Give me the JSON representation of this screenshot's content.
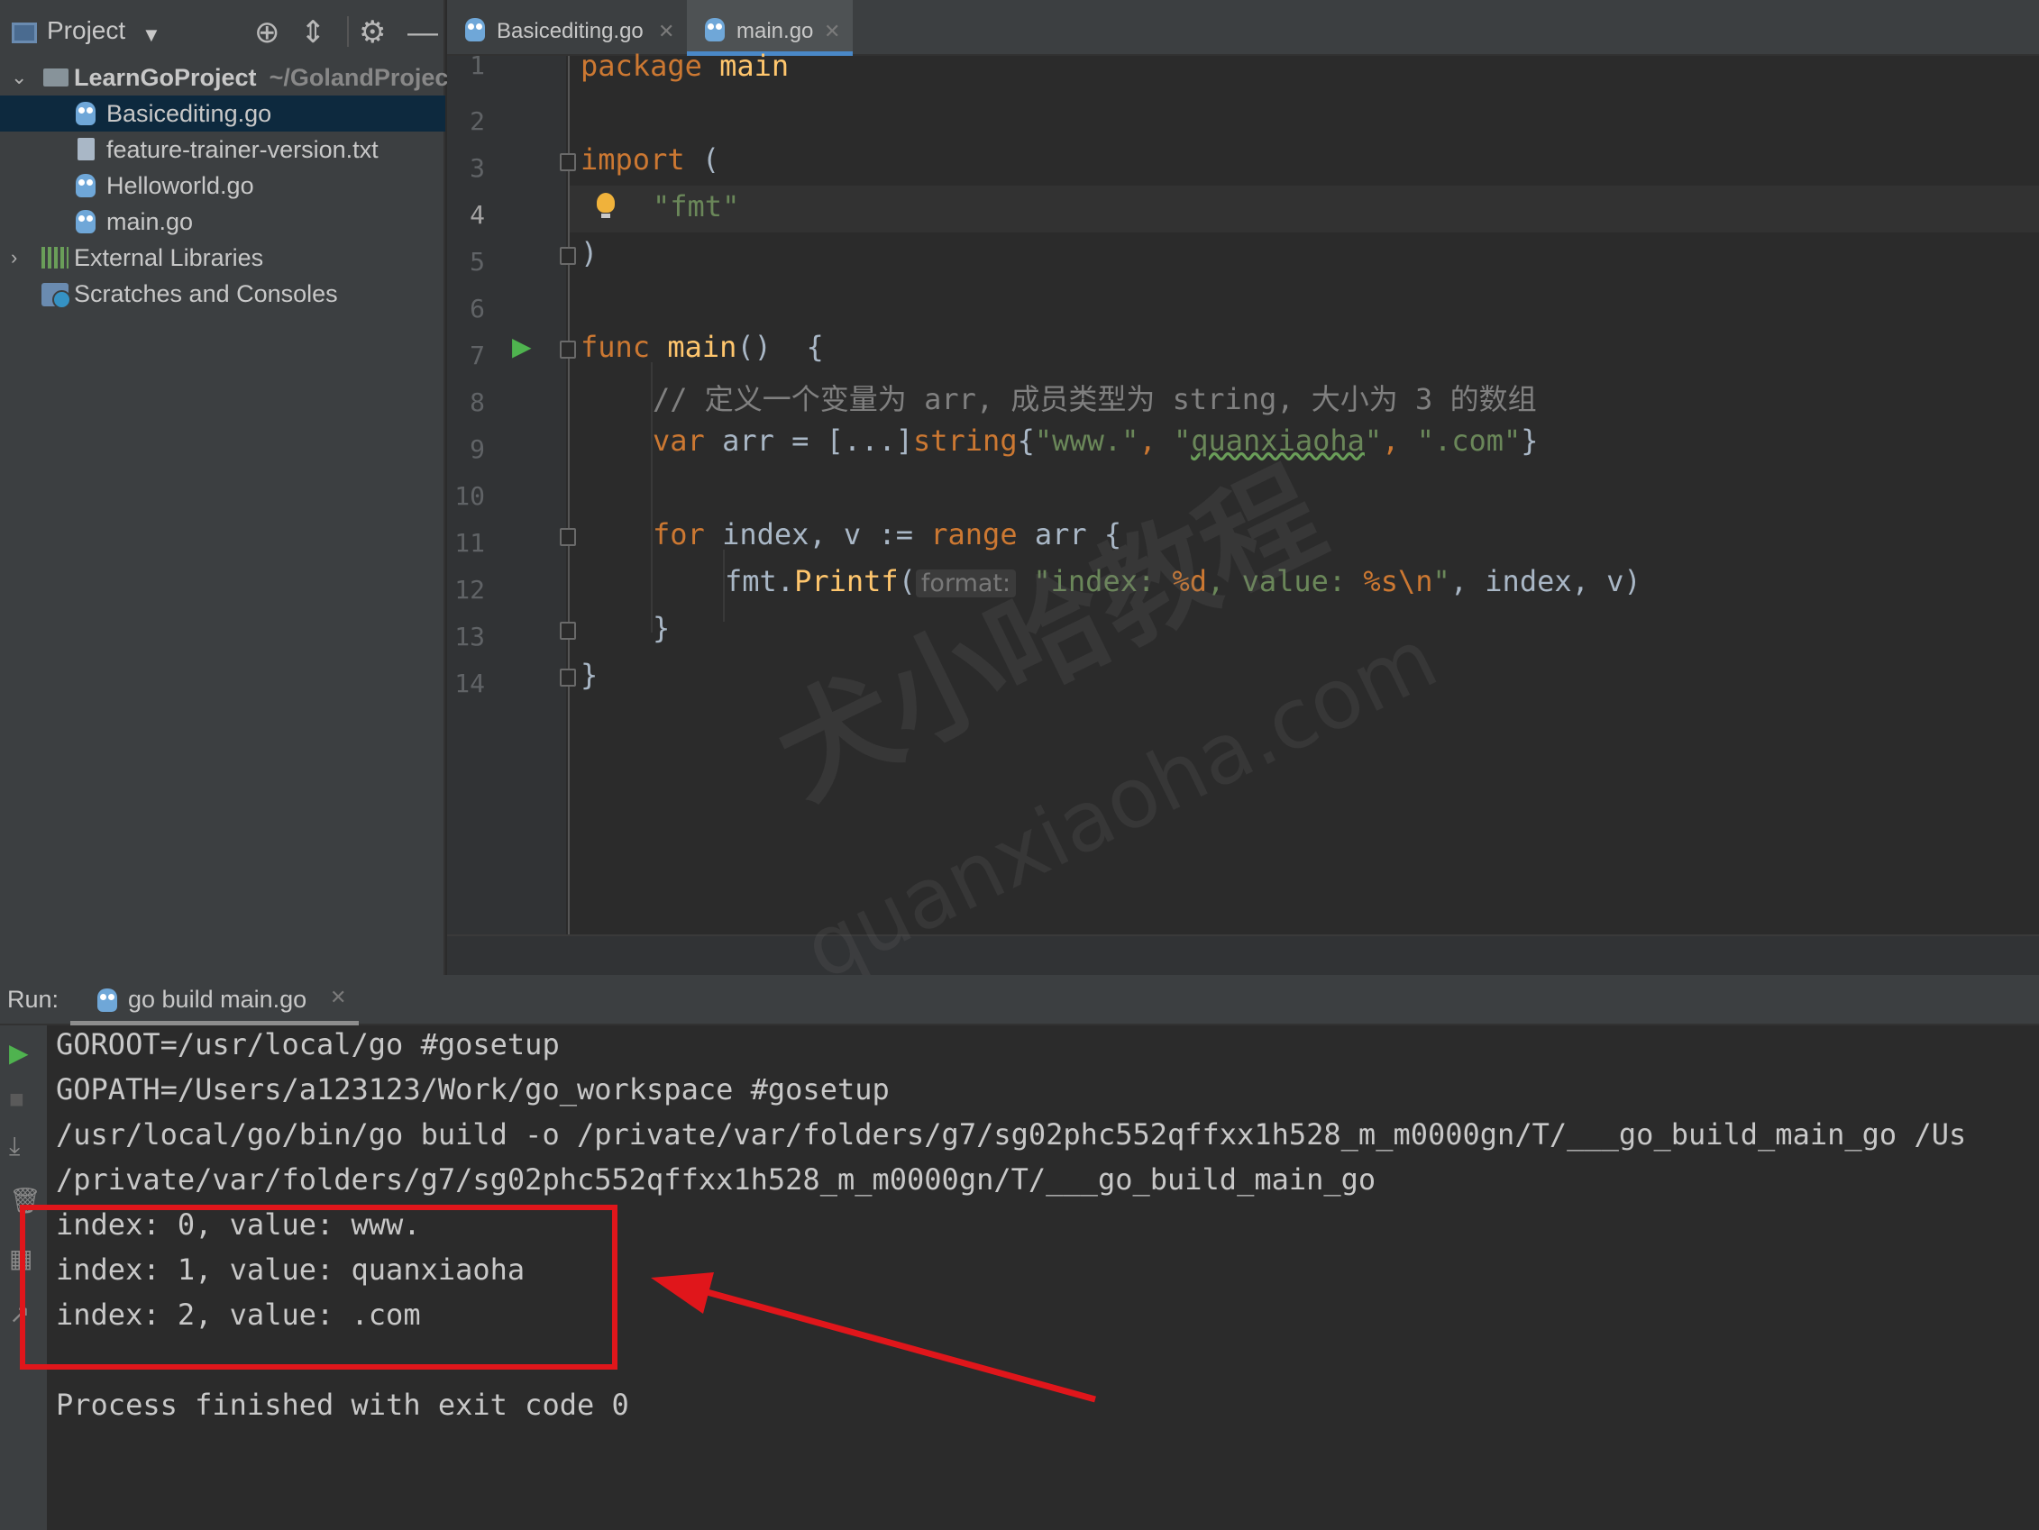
{
  "sidebar": {
    "title": "Project",
    "items": [
      {
        "label": "LearnGoProject",
        "hint": "~/GolandProjec"
      },
      {
        "label": "Basicediting.go"
      },
      {
        "label": "feature-trainer-version.txt"
      },
      {
        "label": "Helloworld.go"
      },
      {
        "label": "main.go"
      },
      {
        "label": "External Libraries"
      },
      {
        "label": "Scratches and Consoles"
      }
    ]
  },
  "tabs": [
    {
      "label": "Basicediting.go"
    },
    {
      "label": "main.go"
    }
  ],
  "editor": {
    "line_numbers": [
      "1",
      "2",
      "3",
      "4",
      "5",
      "6",
      "7",
      "8",
      "9",
      "10",
      "11",
      "12",
      "13",
      "14"
    ],
    "code": {
      "l1_kw": "package",
      "l1_name": " main",
      "l3_kw": "import",
      "l3_rest": " (",
      "l4_str": "\"fmt\"",
      "l5": ")",
      "l7_kw": "func",
      "l7_fn": " main",
      "l7_rest": "()  {",
      "l8_comment": "// 定义一个变量为 arr, 成员类型为 string, 大小为 3 的数组",
      "l9_kw": "var",
      "l9_a": " arr = [...]",
      "l9_type": "string",
      "l9_b": "{",
      "l9_s1": "\"www.\"",
      "l9_c1": ", ",
      "l9_s2a": "\"",
      "l9_s2": "quanxiaoha",
      "l9_s2b": "\"",
      "l9_c2": ", ",
      "l9_s3": "\".com\"",
      "l9_end": "}",
      "l11_kw1": "for",
      "l11_a": " index, v := ",
      "l11_kw2": "range",
      "l11_b": " arr {",
      "l12_a": "fmt.",
      "l12_fn": "Printf",
      "l12_b": "(",
      "l12_hint": "format:",
      "l12_s1": " \"index: ",
      "l12_e1": "%d",
      "l12_s2": ", value: ",
      "l12_e2": "%s\\n",
      "l12_s3": "\"",
      "l12_c": ", index, v)",
      "l13": "}",
      "l14": "}"
    }
  },
  "watermark": {
    "cn": "犬小哈教程",
    "en": "quanxiaoha.com"
  },
  "run": {
    "label": "Run:",
    "tab": "go build main.go",
    "output": [
      "GOROOT=/usr/local/go #gosetup",
      "GOPATH=/Users/a123123/Work/go_workspace #gosetup",
      "/usr/local/go/bin/go build -o /private/var/folders/g7/sg02phc552qffxx1h528_m_m0000gn/T/___go_build_main_go /Us",
      "/private/var/folders/g7/sg02phc552qffxx1h528_m_m0000gn/T/___go_build_main_go",
      "index: 0, value: www.",
      "index: 1, value: quanxiaoha",
      "index: 2, value: .com",
      "",
      "Process finished with exit code 0"
    ]
  },
  "colors": {
    "keyword": "#cc7832",
    "string": "#6a8759",
    "function": "#ffc66d",
    "annotation": "#e0161b"
  }
}
